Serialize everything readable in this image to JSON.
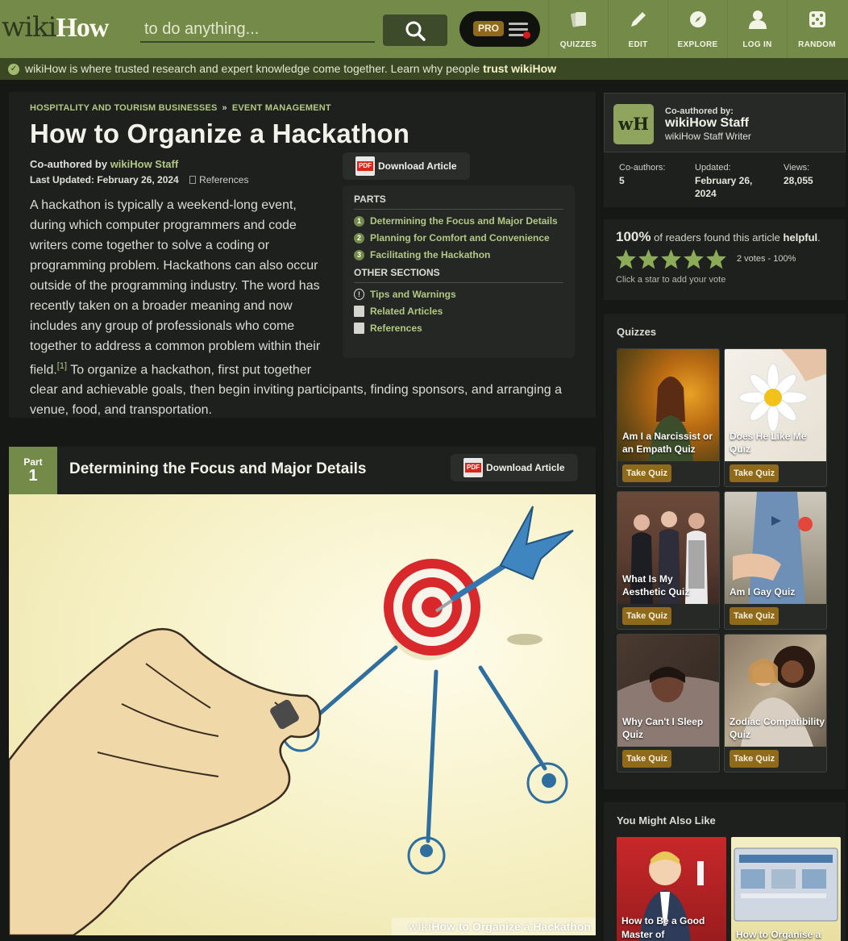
{
  "header": {
    "logo_wiki": "wiki",
    "logo_how": "How",
    "search_placeholder": "to do anything...",
    "pro_label": "PRO",
    "nav": [
      {
        "label": "QUIZZES",
        "icon": "quizzes-icon"
      },
      {
        "label": "EDIT",
        "icon": "pencil-icon"
      },
      {
        "label": "EXPLORE",
        "icon": "compass-icon"
      },
      {
        "label": "LOG IN",
        "icon": "user-icon"
      },
      {
        "label": "RANDOM",
        "icon": "dice-icon"
      }
    ]
  },
  "trust_bar": {
    "text": "wikiHow is where trusted research and expert knowledge come together. Learn why people",
    "link": "trust wikiHow"
  },
  "article": {
    "breadcrumbs": [
      "HOSPITALITY AND TOURISM BUSINESSES",
      "EVENT MANAGEMENT"
    ],
    "breadcrumb_separator": "»",
    "title": "How to Organize a Hackathon",
    "coauthored_prefix": "Co-authored by",
    "coauthor": "wikiHow Staff",
    "last_updated": "Last Updated: February 26, 2024",
    "references_label": "References",
    "download_label": "Download Article",
    "pdf_label": "PDF",
    "intro_part1": "A hackathon is typically a weekend-long event, during which computer programmers and code writers come together to solve a coding or programming problem. Hackathons can also occur outside of the programming industry. The word has recently taken on a broader meaning and now includes any group of professionals who come together to address a common problem within their field.",
    "citation": "[1]",
    "intro_part2": " To organize a hackathon, first put together clear and achievable goals, then begin inviting participants, finding sponsors, and arranging a venue, food, and transportation.",
    "toc": {
      "parts_heading": "PARTS",
      "parts": [
        {
          "num": "1",
          "label": "Determining the Focus and Major Details"
        },
        {
          "num": "2",
          "label": "Planning for Comfort and Convenience"
        },
        {
          "num": "3",
          "label": "Facilitating the Hackathon"
        }
      ],
      "other_heading": "OTHER SECTIONS",
      "other": [
        {
          "label": "Tips and Warnings",
          "icon": "info-icon"
        },
        {
          "label": "Related Articles",
          "icon": "document-icon"
        },
        {
          "label": "References",
          "icon": "document-icon"
        }
      ]
    },
    "part1": {
      "part_label": "Part",
      "part_num": "1",
      "title": "Determining the Focus and Major Details",
      "download_label": "Download Article",
      "watermark_wiki": "wiki",
      "watermark_how": "How",
      "watermark_title": " to Organize a Hackathon"
    }
  },
  "sidebar": {
    "author": {
      "label": "Co-authored by:",
      "name": "wikiHow Staff",
      "role": "wikiHow Staff Writer",
      "badge": "wH",
      "stats": [
        {
          "label": "Co-authors:",
          "value": "5"
        },
        {
          "label": "Updated:",
          "value": "February 26, 2024"
        },
        {
          "label": "Views:",
          "value": "28,055"
        }
      ]
    },
    "helpful": {
      "percent": "100%",
      "text": "of readers found this article",
      "emph": "helpful",
      "votes": "2 votes - 100%",
      "hint": "Click a star to add your vote",
      "stars": 5
    },
    "quizzes": {
      "title": "Quizzes",
      "take_label": "Take Quiz",
      "items": [
        {
          "title": "Am I a Narcissist or an Empath Quiz"
        },
        {
          "title": "Does He Like Me Quiz"
        },
        {
          "title": "What Is My Aesthetic Quiz"
        },
        {
          "title": "Am I Gay Quiz"
        },
        {
          "title": "Why Can't I Sleep Quiz"
        },
        {
          "title": "Zodiac Compatibility Quiz"
        }
      ]
    },
    "also_like": {
      "title": "You Might Also Like",
      "items": [
        {
          "title": "How to Be a Good Master of"
        },
        {
          "title": "How to Organise a"
        }
      ]
    }
  },
  "colors": {
    "header_green": "#748a48",
    "accent_green": "#b2c884",
    "quiz_gold": "#8e6a1a",
    "page_bg": "#151815"
  }
}
